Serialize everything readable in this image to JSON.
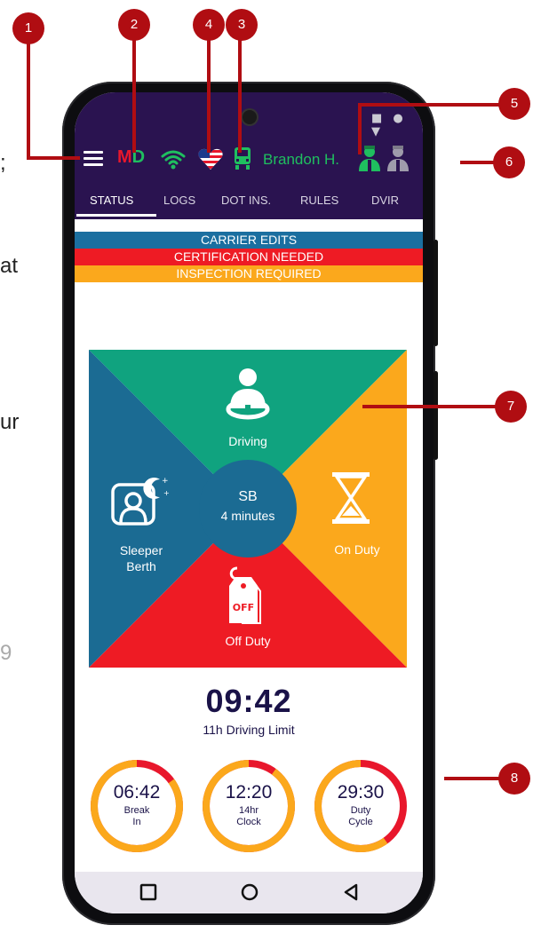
{
  "side_text": [
    ";",
    "at",
    "ur",
    "9"
  ],
  "system_icons": "■ ● ▼",
  "app_logo": {
    "m": "M",
    "d": "D"
  },
  "driver": {
    "name": "Brandon H."
  },
  "tabs": [
    {
      "label": "STATUS",
      "active": true
    },
    {
      "label": "LOGS",
      "active": false
    },
    {
      "label": "DOT INS.",
      "active": false
    },
    {
      "label": "RULES",
      "active": false
    },
    {
      "label": "DVIR",
      "active": false
    }
  ],
  "banners": [
    {
      "text": "CARRIER EDITS",
      "color": "#1b6fa0"
    },
    {
      "text": "CERTIFICATION NEEDED",
      "color": "#ee1b24"
    },
    {
      "text": "INSPECTION REQUIRED",
      "color": "#fba81c"
    }
  ],
  "duty_wheel": {
    "driving": "Driving",
    "sleeper_line1": "Sleeper",
    "sleeper_line2": "Berth",
    "on_duty": "On Duty",
    "off_duty": "Off Duty",
    "off_tag": "OFF",
    "current_status": "SB",
    "current_duration": "4 minutes",
    "colors": {
      "driving": "#10a37f",
      "sleeper": "#1b6b93",
      "on_duty": "#fba81c",
      "off_duty": "#ee1b24"
    }
  },
  "main_timer": {
    "value": "09:42",
    "label": "11h Driving Limit"
  },
  "gauges": [
    {
      "value": "06:42",
      "label_line1": "Break",
      "label_line2": "In",
      "remaining_fraction": 0.85
    },
    {
      "value": "12:20",
      "label_line1": "14hr",
      "label_line2": "Clock",
      "remaining_fraction": 0.9
    },
    {
      "value": "29:30",
      "label_line1": "Duty",
      "label_line2": "Cycle",
      "remaining_fraction": 0.6
    }
  ],
  "callouts": [
    "1",
    "2",
    "3",
    "4",
    "5",
    "6",
    "7",
    "8"
  ],
  "callout_color": "#b00d12",
  "icons": [
    "menu-icon",
    "wifi-icon",
    "heart-flag-icon",
    "truck-icon",
    "driver-icon",
    "codriver-icon",
    "steering-wheel-icon",
    "bed-moon-icon",
    "hourglass-icon",
    "off-tag-icon"
  ]
}
